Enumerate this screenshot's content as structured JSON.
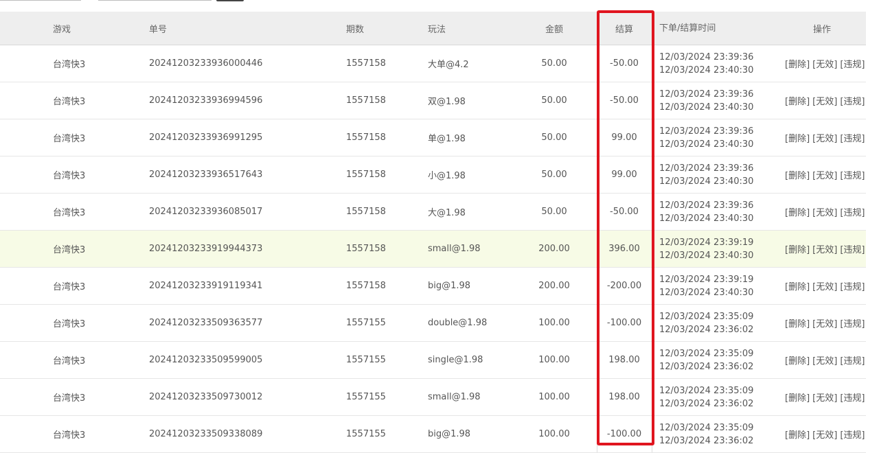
{
  "header": {
    "game": "游戏",
    "order_no": "单号",
    "period": "期数",
    "play": "玩法",
    "amount": "金额",
    "settle": "结算",
    "time": "下单/结算时间",
    "ops": "操作"
  },
  "actions": {
    "delete": "[删除]",
    "invalid": "[无效]",
    "violation": "[违规]"
  },
  "highlight_color": "#e0151f",
  "rows": [
    {
      "game": "台湾快3",
      "order": "20241203233936000446",
      "period": "1557158",
      "play": "大单@4.2",
      "amount": "50.00",
      "settle": "-50.00",
      "order_time": "12/03/2024 23:39:36",
      "settle_time": "12/03/2024 23:40:30",
      "highlighted": false
    },
    {
      "game": "台湾快3",
      "order": "20241203233936994596",
      "period": "1557158",
      "play": "双@1.98",
      "amount": "50.00",
      "settle": "-50.00",
      "order_time": "12/03/2024 23:39:36",
      "settle_time": "12/03/2024 23:40:30",
      "highlighted": false
    },
    {
      "game": "台湾快3",
      "order": "20241203233936991295",
      "period": "1557158",
      "play": "单@1.98",
      "amount": "50.00",
      "settle": "99.00",
      "order_time": "12/03/2024 23:39:36",
      "settle_time": "12/03/2024 23:40:30",
      "highlighted": false
    },
    {
      "game": "台湾快3",
      "order": "20241203233936517643",
      "period": "1557158",
      "play": "小@1.98",
      "amount": "50.00",
      "settle": "99.00",
      "order_time": "12/03/2024 23:39:36",
      "settle_time": "12/03/2024 23:40:30",
      "highlighted": false
    },
    {
      "game": "台湾快3",
      "order": "20241203233936085017",
      "period": "1557158",
      "play": "大@1.98",
      "amount": "50.00",
      "settle": "-50.00",
      "order_time": "12/03/2024 23:39:36",
      "settle_time": "12/03/2024 23:40:30",
      "highlighted": false
    },
    {
      "game": "台湾快3",
      "order": "20241203233919944373",
      "period": "1557158",
      "play": "small@1.98",
      "amount": "200.00",
      "settle": "396.00",
      "order_time": "12/03/2024 23:39:19",
      "settle_time": "12/03/2024 23:40:30",
      "highlighted": true
    },
    {
      "game": "台湾快3",
      "order": "20241203233919119341",
      "period": "1557158",
      "play": "big@1.98",
      "amount": "200.00",
      "settle": "-200.00",
      "order_time": "12/03/2024 23:39:19",
      "settle_time": "12/03/2024 23:40:30",
      "highlighted": false
    },
    {
      "game": "台湾快3",
      "order": "20241203233509363577",
      "period": "1557155",
      "play": "double@1.98",
      "amount": "100.00",
      "settle": "-100.00",
      "order_time": "12/03/2024 23:35:09",
      "settle_time": "12/03/2024 23:36:02",
      "highlighted": false
    },
    {
      "game": "台湾快3",
      "order": "20241203233509599005",
      "period": "1557155",
      "play": "single@1.98",
      "amount": "100.00",
      "settle": "198.00",
      "order_time": "12/03/2024 23:35:09",
      "settle_time": "12/03/2024 23:36:02",
      "highlighted": false
    },
    {
      "game": "台湾快3",
      "order": "20241203233509730012",
      "period": "1557155",
      "play": "small@1.98",
      "amount": "100.00",
      "settle": "198.00",
      "order_time": "12/03/2024 23:35:09",
      "settle_time": "12/03/2024 23:36:02",
      "highlighted": false
    },
    {
      "game": "台湾快3",
      "order": "20241203233509338089",
      "period": "1557155",
      "play": "big@1.98",
      "amount": "100.00",
      "settle": "-100.00",
      "order_time": "12/03/2024 23:35:09",
      "settle_time": "12/03/2024 23:36:02",
      "highlighted": false
    }
  ]
}
